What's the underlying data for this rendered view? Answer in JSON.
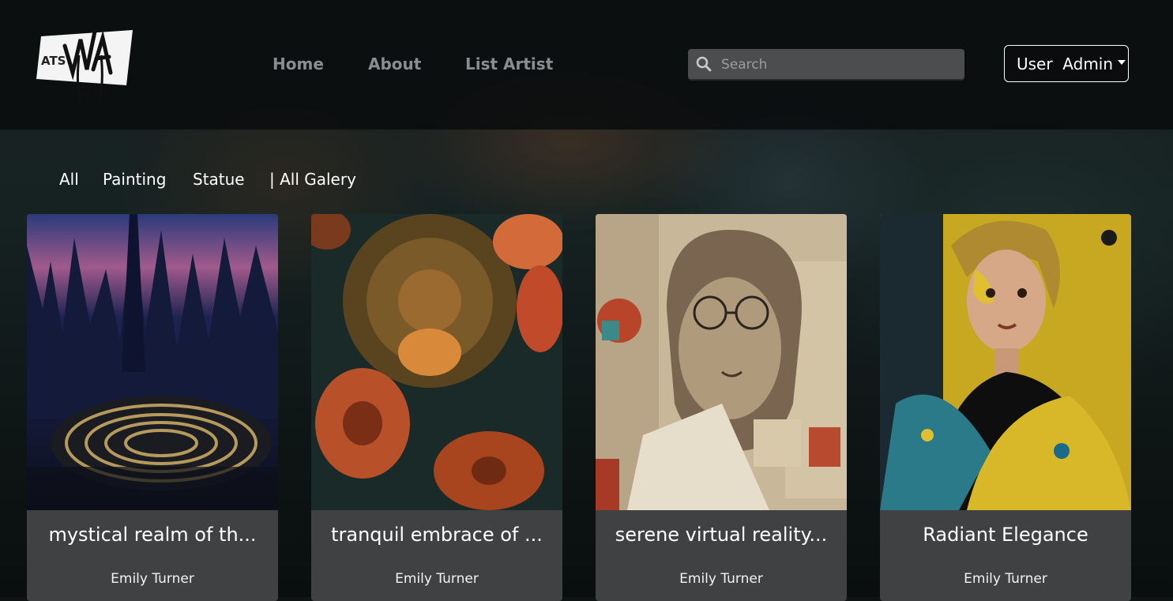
{
  "header": {
    "logo_text": "ATS",
    "nav": [
      {
        "label": "Home"
      },
      {
        "label": "About"
      },
      {
        "label": "List Artist"
      }
    ],
    "search": {
      "placeholder": "Search",
      "value": ""
    },
    "user_menu": {
      "label": "User  Admin"
    }
  },
  "filters": [
    {
      "label": "All"
    },
    {
      "label": "Painting"
    },
    {
      "label": "Statue"
    },
    {
      "label": "| All Galery"
    }
  ],
  "artworks": [
    {
      "title": "mystical realm of th...",
      "artist": "Emily Turner"
    },
    {
      "title": "tranquil embrace of ...",
      "artist": "Emily Turner"
    },
    {
      "title": "serene virtual reality...",
      "artist": "Emily Turner"
    },
    {
      "title": "Radiant Elegance",
      "artist": "Emily Turner"
    }
  ],
  "colors": {
    "header_bg": "#0a0c0e",
    "nav_text": "#8a8d90",
    "card_bg": "#404142",
    "search_bg": "#4b4d4f"
  }
}
